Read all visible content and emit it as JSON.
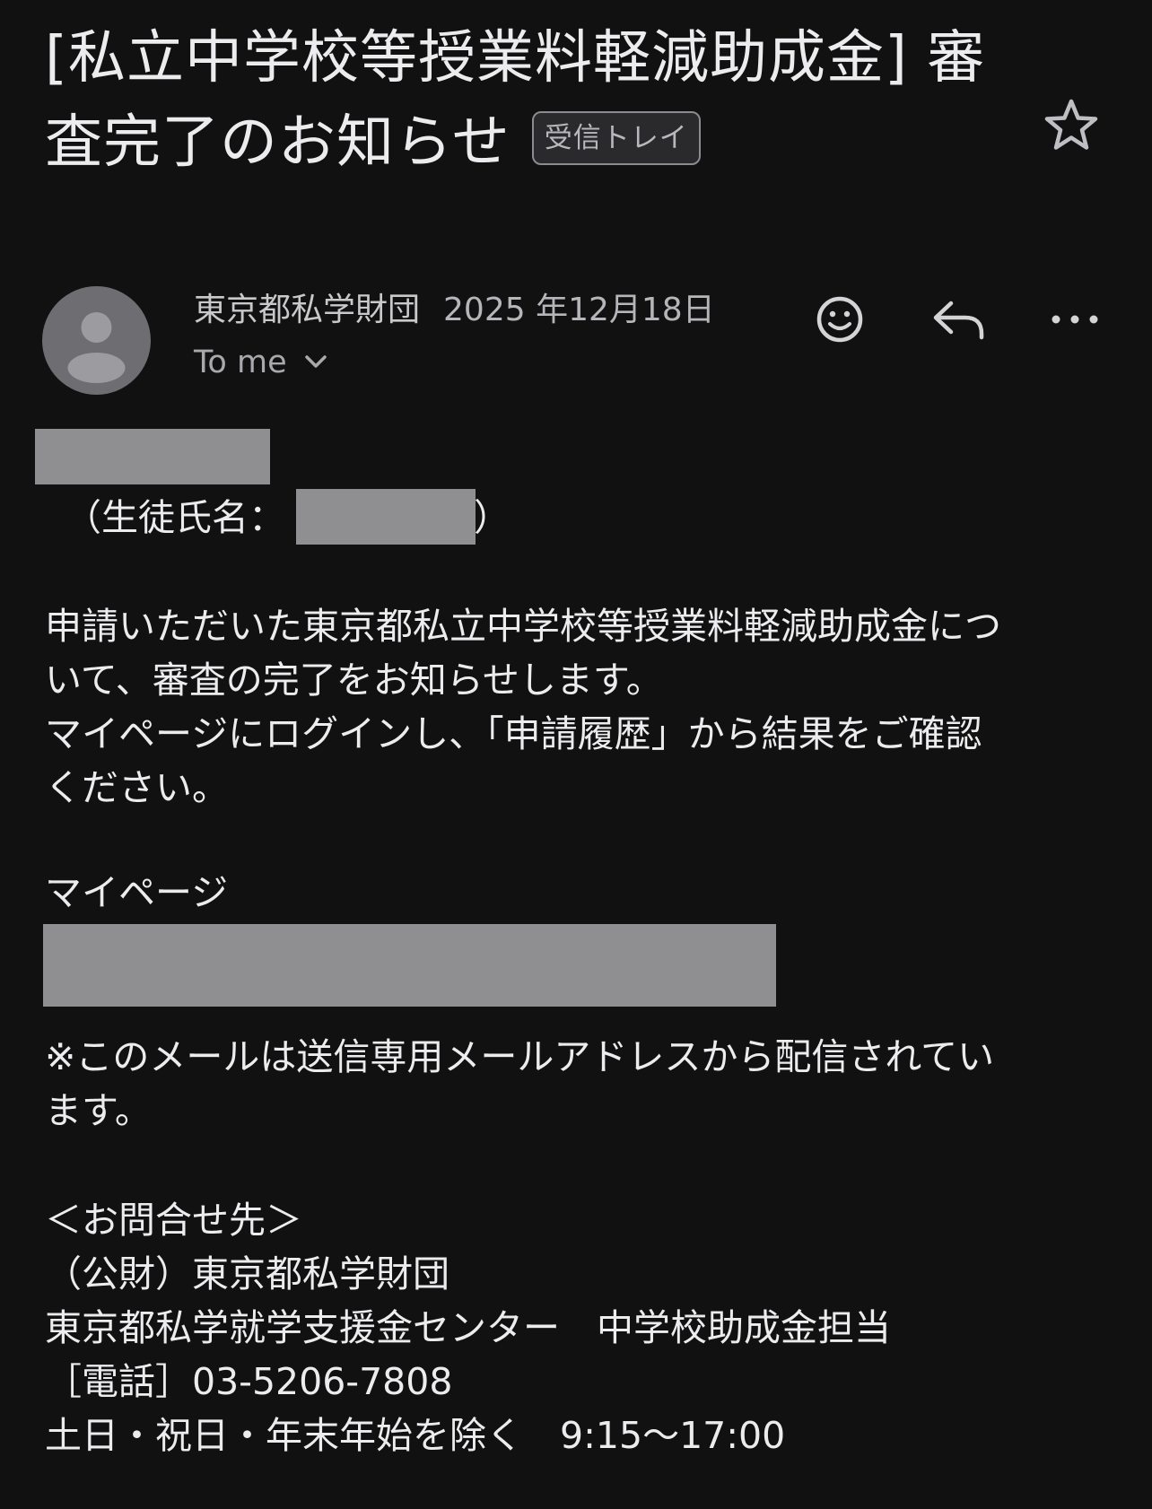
{
  "email": {
    "subject_line1": "[私立中学校等授業料軽減助成金] 審",
    "subject_line2": "査完了のお知らせ",
    "label_badge": "受信トレイ",
    "sender": "東京都私学財団",
    "date": "2025 年12月18日",
    "recipient": "To me"
  },
  "icons": {
    "star": "star-icon",
    "avatar": "person-icon",
    "emoji": "smiley-icon",
    "reply": "reply-icon",
    "more": "more-icon",
    "expand": "chevron-down-icon"
  },
  "body": {
    "student_label": "（生徒氏名：",
    "student_close": "）",
    "para1_line1": "申請いただいた東京都私立中学校等授業料軽減助成金につ",
    "para1_line2": "いて、審査の完了をお知らせします。",
    "para1_line3": "マイページにログインし、「申請履歴」から結果をご確認",
    "para1_line4": "ください。",
    "mypage_label": "マイページ",
    "notice_line1": "※このメールは送信専用メールアドレスから配信されてい",
    "notice_line2": "ます。",
    "contact_heading": "＜お問合せ先＞",
    "contact_org": "（公財）東京都私学財団",
    "contact_center": "東京都私学就学支援金センター　中学校助成金担当",
    "contact_phone": "［電話］03-5206-7808",
    "contact_hours": "土日・祝日・年末年始を除く　9:15〜17:00"
  },
  "colors": {
    "background": "#111112",
    "text": "#ececee",
    "redaction": "#8f8f91",
    "avatar": "#6e6e72"
  }
}
